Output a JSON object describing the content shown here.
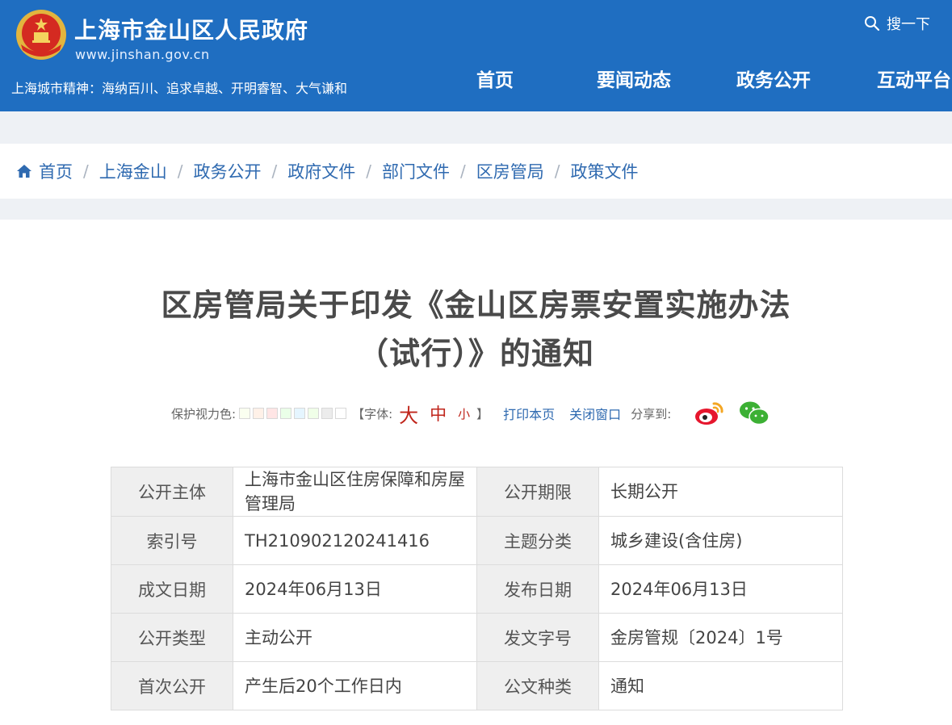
{
  "header": {
    "site_title": "上海市金山区人民政府",
    "site_url": "www.jinshan.gov.cn",
    "slogan": "上海城市精神：海纳百川、追求卓越、开明睿智、大气谦和",
    "search_label": "搜一下",
    "nav": [
      "首页",
      "要闻动态",
      "政务公开",
      "互动平台"
    ],
    "colors": {
      "bar": "#1f6ec1"
    }
  },
  "breadcrumb": [
    "首页",
    "上海金山",
    "政务公开",
    "政府文件",
    "部门文件",
    "区房管局",
    "政策文件"
  ],
  "document": {
    "title_line1": "区房管局关于印发《金山区房票安置实施办法",
    "title_line2": "（试行）》的通知"
  },
  "tools": {
    "eye_color_label": "保护视力色:",
    "swatch_colors": [
      "#fafff0",
      "#fff1e8",
      "#ffe5e5",
      "#eaffe8",
      "#e5f5ff",
      "#f0ffe8",
      "#ececec",
      "#ffffff"
    ],
    "font_label": "【字体:",
    "font_big": "大",
    "font_mid": "中",
    "font_small": "小",
    "font_close": "】",
    "print": "打印本页",
    "close_window": "关闭窗口",
    "share_label": "分享到:"
  },
  "info": {
    "rows": [
      {
        "k1": "公开主体",
        "v1": "上海市金山区住房保障和房屋管理局",
        "k2": "公开期限",
        "v2": "长期公开"
      },
      {
        "k1": "索引号",
        "v1": "TH210902120241416",
        "k2": "主题分类",
        "v2": "城乡建设(含住房)"
      },
      {
        "k1": "成文日期",
        "v1": "2024年06月13日",
        "k2": "发布日期",
        "v2": "2024年06月13日"
      },
      {
        "k1": "公开类型",
        "v1": "主动公开",
        "k2": "发文字号",
        "v2": "金房管规〔2024〕1号"
      },
      {
        "k1": "首次公开",
        "v1": "产生后20个工作日内",
        "k2": "公文种类",
        "v2": "通知"
      }
    ]
  }
}
